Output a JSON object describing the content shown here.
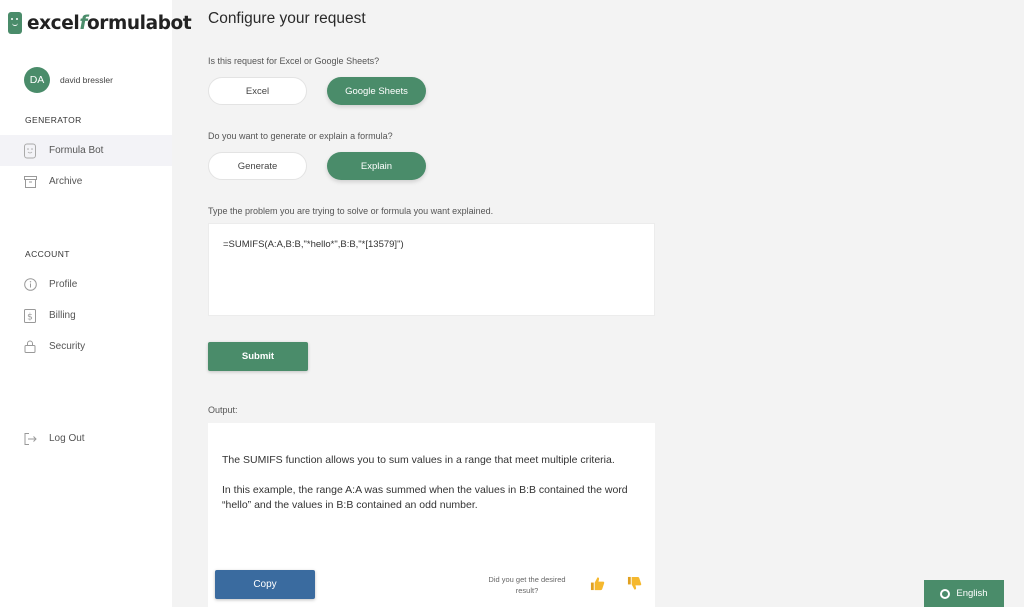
{
  "brand": {
    "logo_pre": "excel",
    "logo_accent": "f",
    "logo_post": "ormulabot",
    "color": "#4a8c6a"
  },
  "user": {
    "initials": "DA",
    "name": "david bressler"
  },
  "sidebar": {
    "generator_title": "GENERATOR",
    "generator_items": [
      {
        "label": "Formula Bot",
        "icon": "robot-icon",
        "active": true
      },
      {
        "label": "Archive",
        "icon": "archive-icon",
        "active": false
      }
    ],
    "account_title": "ACCOUNT",
    "account_items": [
      {
        "label": "Profile",
        "icon": "info-icon"
      },
      {
        "label": "Billing",
        "icon": "dollar-icon"
      },
      {
        "label": "Security",
        "icon": "lock-icon"
      }
    ],
    "logout_label": "Log Out"
  },
  "main": {
    "title": "Configure your request",
    "platform_question": "Is this request for Excel or Google Sheets?",
    "platform_options": [
      "Excel",
      "Google Sheets"
    ],
    "platform_selected": "Google Sheets",
    "mode_question": "Do you want to generate or explain a formula?",
    "mode_options": [
      "Generate",
      "Explain"
    ],
    "mode_selected": "Explain",
    "input_label": "Type the problem you are trying to solve or formula you want explained.",
    "input_value": "=SUMIFS(A:A,B:B,\"*hello*\",B:B,\"*[13579]\")",
    "submit_label": "Submit",
    "output_label": "Output:",
    "output_paragraphs": [
      "The SUMIFS function allows you to sum values in a range that meet multiple criteria.",
      "In this example, the range A:A was summed when the values in B:B contained the word “hello” and the values in B:B contained an odd number."
    ],
    "copy_label": "Copy",
    "feedback_question": "Did you get the desired result?"
  },
  "language": {
    "label": "English"
  },
  "colors": {
    "accent": "#4a8c6a",
    "copy": "#3a6b9f",
    "background": "#f3f3f3"
  }
}
